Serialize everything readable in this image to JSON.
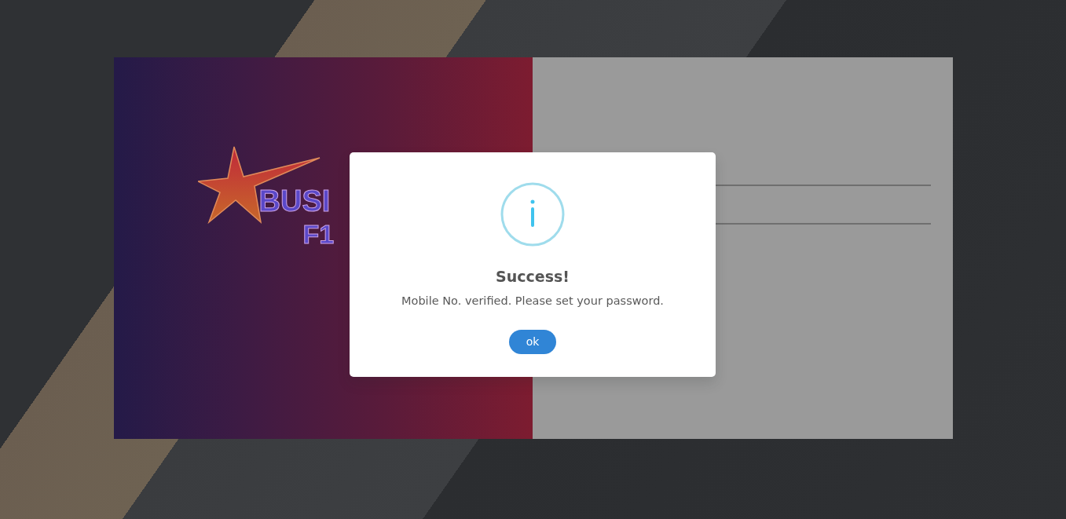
{
  "logo": {
    "line_1": "BUSI",
    "line_2": "F1"
  },
  "form": {
    "fields": [
      {
        "kind": "underline"
      },
      {
        "kind": "underline"
      }
    ]
  },
  "dialog": {
    "kind": "info",
    "title": "Success!",
    "message": "Mobile No. verified. Please set your password.",
    "button": "ok"
  }
}
